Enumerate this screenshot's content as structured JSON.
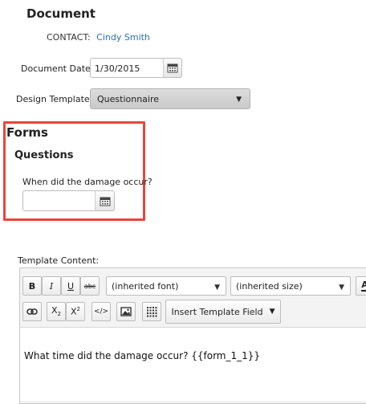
{
  "document": {
    "title": "Document",
    "contact_label": "CONTACT:",
    "contact_name": "Cindy Smith",
    "date_label": "Document Date:",
    "date_value": "1/30/2015",
    "template_label": "Design Template:",
    "template_value": "Questionnaire"
  },
  "forms": {
    "title": "Forms",
    "questions_title": "Questions",
    "question_label": "When did the damage occur?",
    "question_value": ""
  },
  "editor": {
    "label": "Template Content:",
    "font_value": "(inherited font)",
    "size_value": "(inherited size)",
    "insert_field_label": "Insert Template Field",
    "buttons": {
      "bold": "B",
      "italic": "I",
      "underline": "U",
      "strike": "abc"
    },
    "content": "What time did the damage occur? {{form_1_1}}"
  },
  "icons": [
    "calendar-icon",
    "chevron-down-icon",
    "link-icon",
    "subscript-icon",
    "superscript-icon",
    "code-icon",
    "image-icon",
    "table-icon"
  ],
  "colors": {
    "accent_link": "#2a6fb0",
    "highlight_box": "#e8463a"
  }
}
